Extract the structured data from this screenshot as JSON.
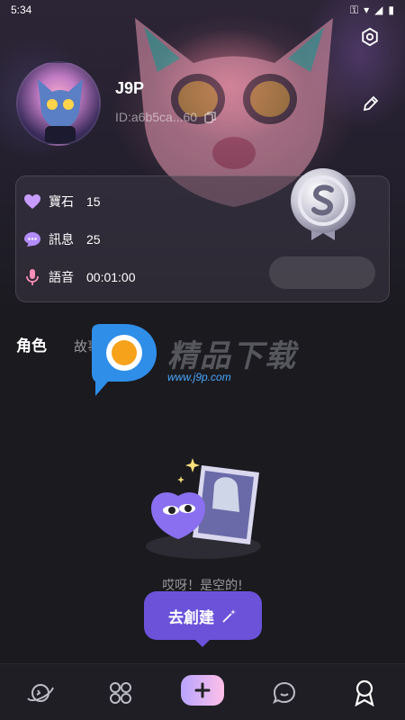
{
  "status_bar": {
    "time": "5:34"
  },
  "profile": {
    "name": "J9P",
    "id": "ID:a6b5ca...60"
  },
  "stats": [
    {
      "label": "寶石",
      "value": "15",
      "icon": "gem-icon"
    },
    {
      "label": "訊息",
      "value": "25",
      "icon": "message-icon"
    },
    {
      "label": "語音",
      "value": "00:01:00",
      "icon": "microphone-icon"
    }
  ],
  "tabs": [
    {
      "label": "角色",
      "active": true
    },
    {
      "label": "故事",
      "active": false
    }
  ],
  "watermark": {
    "title": "精品下载",
    "url": "www.j9p.com"
  },
  "empty_state": {
    "message": "哎呀！是空的!",
    "button": "去創建"
  },
  "bottom_nav": [
    "planet-icon",
    "grid-icon",
    "add-icon",
    "chat-icon",
    "profile-icon"
  ],
  "colors": {
    "accent": "#6b52d9",
    "background": "#1a1a1f"
  }
}
